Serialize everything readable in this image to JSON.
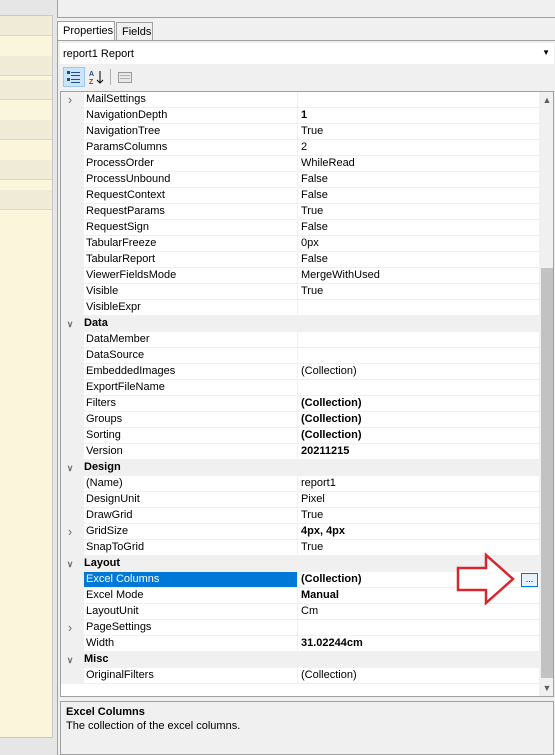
{
  "tabs": {
    "properties": "Properties",
    "fields": "Fields"
  },
  "object_selector": {
    "value": "report1  Report"
  },
  "toolbar": {
    "categorized": "categorized-icon",
    "alphabetical": "alphabetical-icon",
    "property_pages": "property-pages-icon"
  },
  "grid": {
    "rows": [
      {
        "kind": "prop",
        "name": "MailSettings",
        "value": "",
        "expand": "collapsed"
      },
      {
        "kind": "prop",
        "name": "NavigationDepth",
        "value": "1",
        "bold": true
      },
      {
        "kind": "prop",
        "name": "NavigationTree",
        "value": "True"
      },
      {
        "kind": "prop",
        "name": "ParamsColumns",
        "value": "2"
      },
      {
        "kind": "prop",
        "name": "ProcessOrder",
        "value": "WhileRead"
      },
      {
        "kind": "prop",
        "name": "ProcessUnbound",
        "value": "False"
      },
      {
        "kind": "prop",
        "name": "RequestContext",
        "value": "False"
      },
      {
        "kind": "prop",
        "name": "RequestParams",
        "value": "True"
      },
      {
        "kind": "prop",
        "name": "RequestSign",
        "value": "False"
      },
      {
        "kind": "prop",
        "name": "TabularFreeze",
        "value": "0px"
      },
      {
        "kind": "prop",
        "name": "TabularReport",
        "value": "False"
      },
      {
        "kind": "prop",
        "name": "ViewerFieldsMode",
        "value": "MergeWithUsed"
      },
      {
        "kind": "prop",
        "name": "Visible",
        "value": "True"
      },
      {
        "kind": "prop",
        "name": "VisibleExpr",
        "value": ""
      },
      {
        "kind": "cat",
        "name": "Data"
      },
      {
        "kind": "prop",
        "name": "DataMember",
        "value": ""
      },
      {
        "kind": "prop",
        "name": "DataSource",
        "value": ""
      },
      {
        "kind": "prop",
        "name": "EmbeddedImages",
        "value": "(Collection)"
      },
      {
        "kind": "prop",
        "name": "ExportFileName",
        "value": ""
      },
      {
        "kind": "prop",
        "name": "Filters",
        "value": "(Collection)",
        "bold": true
      },
      {
        "kind": "prop",
        "name": "Groups",
        "value": "(Collection)",
        "bold": true
      },
      {
        "kind": "prop",
        "name": "Sorting",
        "value": "(Collection)",
        "bold": true
      },
      {
        "kind": "prop",
        "name": "Version",
        "value": "20211215",
        "bold": true
      },
      {
        "kind": "cat",
        "name": "Design"
      },
      {
        "kind": "prop",
        "name": "(Name)",
        "value": "report1"
      },
      {
        "kind": "prop",
        "name": "DesignUnit",
        "value": "Pixel"
      },
      {
        "kind": "prop",
        "name": "DrawGrid",
        "value": "True"
      },
      {
        "kind": "prop",
        "name": "GridSize",
        "value": "4px, 4px",
        "bold": true,
        "expand": "collapsed"
      },
      {
        "kind": "prop",
        "name": "SnapToGrid",
        "value": "True"
      },
      {
        "kind": "cat",
        "name": "Layout"
      },
      {
        "kind": "prop",
        "name": "Excel Columns",
        "value": "(Collection)",
        "bold": true,
        "selected": true,
        "ellipsis": "..."
      },
      {
        "kind": "prop",
        "name": "Excel Mode",
        "value": "Manual",
        "bold": true
      },
      {
        "kind": "prop",
        "name": "LayoutUnit",
        "value": "Cm"
      },
      {
        "kind": "prop",
        "name": "PageSettings",
        "value": "",
        "expand": "collapsed"
      },
      {
        "kind": "prop",
        "name": "Width",
        "value": "31.02244cm",
        "bold": true
      },
      {
        "kind": "cat",
        "name": "Misc"
      },
      {
        "kind": "prop",
        "name": "OriginalFilters",
        "value": "(Collection)"
      }
    ]
  },
  "description": {
    "title": "Excel Columns",
    "text": "The collection of the excel columns."
  },
  "colors": {
    "selection": "#0078d7",
    "annotation_arrow": "#d9262c",
    "left_panel": "#fbf5dc"
  }
}
